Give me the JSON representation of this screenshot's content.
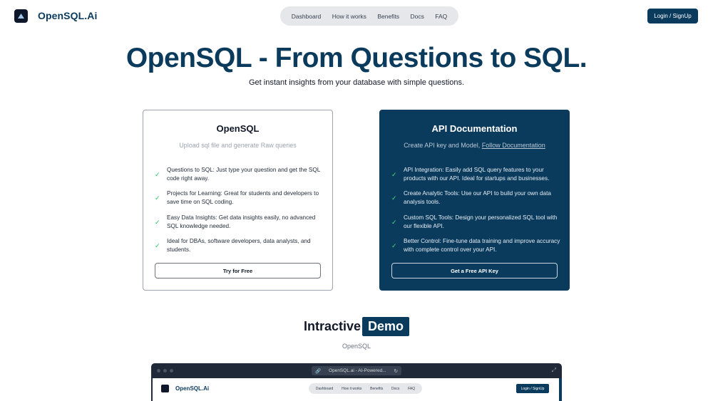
{
  "header": {
    "logo_text": "OpenSQL.Ai",
    "nav": [
      "Dashboard",
      "How it works",
      "Benefits",
      "Docs",
      "FAQ"
    ],
    "login_label": "Login / SignUp"
  },
  "hero": {
    "title": "OpenSQL - From Questions to SQL.",
    "subtitle": "Get instant insights from your database with simple questions."
  },
  "cards": {
    "left": {
      "title": "OpenSQL",
      "description": "Upload sql file and generate Raw queries",
      "features": [
        "Questions to SQL: Just type your question and get the SQL code right away.",
        "Projects for Learning: Great for students and developers to save time on SQL coding.",
        "Easy Data Insights: Get data insights easily, no advanced SQL knowledge needed.",
        "Ideal for DBAs, software developers, data analysts, and students."
      ],
      "button": "Try for Free"
    },
    "right": {
      "title": "API Documentation",
      "description": "Create API key and Model,",
      "description_link": "Follow Documentation",
      "features": [
        "API Integration: Easily add SQL query features to your products with our API. Ideal for startups and businesses.",
        "Create Analytic Tools: Use our API to build your own data analysis tools.",
        "Custom SQL Tools: Design your personalized SQL tool with our flexible API.",
        "Better Control: Fine-tune data training and improve accuracy with complete control over your API."
      ],
      "button": "Get a Free API Key"
    }
  },
  "demo": {
    "title": "Intractive",
    "badge": "Demo",
    "subtitle": "OpenSQL"
  },
  "browser": {
    "url": "OpenSQL.ai - AI-Powered...",
    "logo_text": "OpenSQL.Ai",
    "nav": [
      "Dashboard",
      "How it works",
      "Benefits",
      "Docs",
      "FAQ"
    ],
    "login_label": "Login / SignUp"
  },
  "colors": {
    "brand": "#0b3b5c",
    "check": "#22c55e"
  }
}
